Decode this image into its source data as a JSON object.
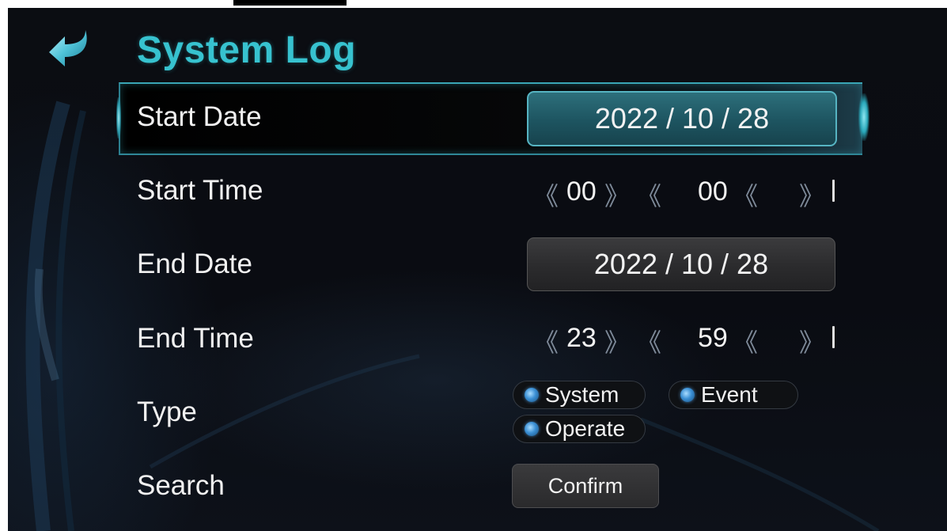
{
  "header": {
    "title": "System Log",
    "back_icon": "back-arrow-icon"
  },
  "rows": {
    "start_date_label": "Start Date",
    "start_time_label": "Start Time",
    "end_date_label": "End Date",
    "end_time_label": "End Time",
    "type_label": "Type",
    "search_label": "Search"
  },
  "start_date": {
    "value": "2022 / 10 / 28"
  },
  "end_date": {
    "value": "2022 / 10 / 28"
  },
  "start_time": {
    "left_arrow": "《",
    "right_arrow": "》",
    "hour": "00",
    "minute": "00"
  },
  "end_time": {
    "left_arrow": "《",
    "right_arrow": "》",
    "hour": "23",
    "minute": "59"
  },
  "type_options": [
    {
      "label": "System"
    },
    {
      "label": "Event"
    },
    {
      "label": "Operate"
    }
  ],
  "search": {
    "confirm_label": "Confirm"
  },
  "colors": {
    "accent": "#37c2cf",
    "background": "#0b0d12",
    "radio": "#3a8fd4"
  }
}
